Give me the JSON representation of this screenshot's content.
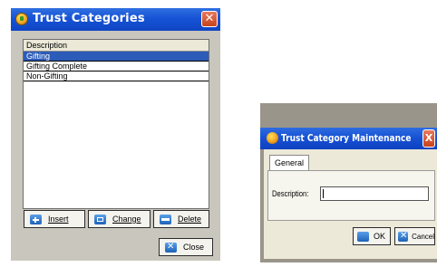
{
  "trust_categories": {
    "title": "Trust Categories",
    "close_glyph": "✕",
    "list": {
      "column_header": "Description",
      "rows": [
        {
          "label": "Gifting",
          "selected": true
        },
        {
          "label": "Gifting Complete",
          "selected": false
        },
        {
          "label": "Non-Gifting",
          "selected": false
        }
      ]
    },
    "buttons": {
      "insert": "Insert",
      "change": "Change",
      "delete": "Delete",
      "close": "Close"
    }
  },
  "maintenance": {
    "title": "Trust Category Maintenance",
    "close_glyph": "X",
    "tab_general": "General",
    "description_label": "Description:",
    "description_value": "",
    "buttons": {
      "ok": "OK",
      "cancel": "Cancel"
    }
  },
  "colors": {
    "titlebar": "#1653d6",
    "selection": "#2c5bb8",
    "close_button": "#c8421d"
  }
}
